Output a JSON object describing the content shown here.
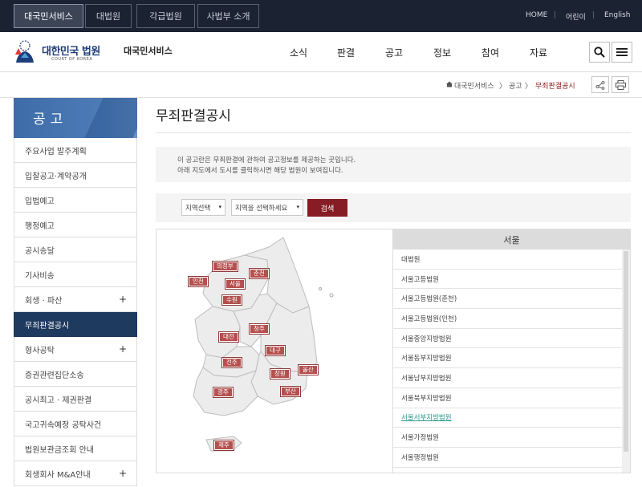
{
  "topbar": {
    "tabs": [
      "대국민서비스",
      "대법원",
      "각급법원",
      "사법부 소개"
    ],
    "links": [
      "HOME",
      "어린이",
      "English"
    ],
    "separators": [
      "|",
      "|"
    ]
  },
  "header": {
    "logo_title": "대한민국 법원",
    "logo_sub": "COURT OF KOREA",
    "site_name": "대국민서비스",
    "nav": [
      "소식",
      "판결",
      "공고",
      "정보",
      "참여",
      "자료"
    ],
    "search_icon": "search-icon",
    "menu_icon": "hamburger-icon"
  },
  "breadcrumb": {
    "home_icon": "home-icon",
    "items": [
      "대국민서비스",
      "공고",
      "무죄판결공시"
    ],
    "separators": [
      "〉",
      "〉"
    ],
    "share_icon": "share-icon",
    "print_icon": "print-icon"
  },
  "sidebar": {
    "title": "공고",
    "items": [
      {
        "label": "주요사업 발주계획",
        "expandable": false
      },
      {
        "label": "입찰공고·계약공개",
        "expandable": false
      },
      {
        "label": "입법예고",
        "expandable": false
      },
      {
        "label": "행정예고",
        "expandable": false
      },
      {
        "label": "공시송달",
        "expandable": false
      },
      {
        "label": "기사비송",
        "expandable": false
      },
      {
        "label": "회생 · 파산",
        "expandable": true
      },
      {
        "label": "무죄판결공시",
        "expandable": false,
        "active": true
      },
      {
        "label": "형사공탁",
        "expandable": true
      },
      {
        "label": "증권관련집단소송",
        "expandable": false
      },
      {
        "label": "공시최고 · 제권판결",
        "expandable": false
      },
      {
        "label": "국고귀속예정 공탁사건",
        "expandable": false
      },
      {
        "label": "법원보관금조회 안내",
        "expandable": false
      },
      {
        "label": "회생회사 M&A안내",
        "expandable": true
      }
    ],
    "plus_symbol": "+"
  },
  "main": {
    "title": "무죄판결공시",
    "info_line1": "이 공고란은 무죄판결에 관하여 공고정보를 제공하는 곳입니다.",
    "info_line2": "아래 지도에서 도시를 클릭하시면 해당 법원이 보여집니다.",
    "search": {
      "region_select": "지역선택",
      "court_select": "지역을 선택하세요",
      "button": "검색"
    }
  },
  "map": {
    "cities": [
      "인천",
      "의정부",
      "서울",
      "춘천",
      "수원",
      "청주",
      "대전",
      "대구",
      "전주",
      "창원",
      "울산",
      "부산",
      "광주",
      "제주"
    ]
  },
  "court_panel": {
    "region": "서울",
    "courts": [
      "대법원",
      "서울고등법원",
      "서울고등법원(춘천)",
      "서울고등법원(인천)",
      "서울중앙지방법원",
      "서울동부지방법원",
      "서울남부지방법원",
      "서울북부지방법원",
      "서울서부지방법원",
      "서울가정법원",
      "서울행정법원"
    ],
    "highlighted_index": 8
  },
  "colors": {
    "topbar": "#1b2333",
    "sidebar_header": "#4d7bb6",
    "sidebar_active": "#1f3a5f",
    "search_button": "#861d24",
    "city_label": "#b5504f",
    "link_highlight": "#2a9a8e"
  }
}
